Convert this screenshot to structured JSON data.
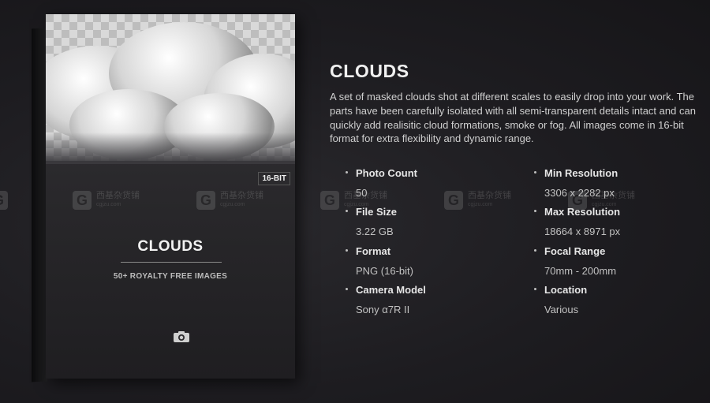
{
  "product": {
    "title": "CLOUDS",
    "description": "A set of masked clouds shot at different scales to easily drop into your work. The parts have been carefully isolated with all semi-transparent details intact and can quickly add realisitic cloud formations, smoke or fog. All images come in 16-bit format for extra flexibility and dynamic range."
  },
  "box": {
    "title": "CLOUDS",
    "subtitle": "50+ ROYALTY FREE IMAGES",
    "badge": "16-BIT",
    "icon": "camera-icon"
  },
  "specs_left": [
    {
      "label": "Photo Count",
      "value": "50"
    },
    {
      "label": "File Size",
      "value": "3.22 GB"
    },
    {
      "label": "Format",
      "value": "PNG (16-bit)"
    },
    {
      "label": "Camera Model",
      "value": "Sony α7R II"
    }
  ],
  "specs_right": [
    {
      "label": "Min Resolution",
      "value": "3306 x 2282 px"
    },
    {
      "label": "Max Resolution",
      "value": "18664 x 8971 px"
    },
    {
      "label": "Focal Range",
      "value": "70mm - 200mm"
    },
    {
      "label": "Location",
      "value": "Various"
    }
  ],
  "watermark": {
    "letter": "G",
    "text": "西基杂货铺",
    "url": "cgjzu.com"
  },
  "colors": {
    "background": "#1b1a1d",
    "text_primary": "#f0f0f0",
    "text_secondary": "#cfcfcf"
  }
}
